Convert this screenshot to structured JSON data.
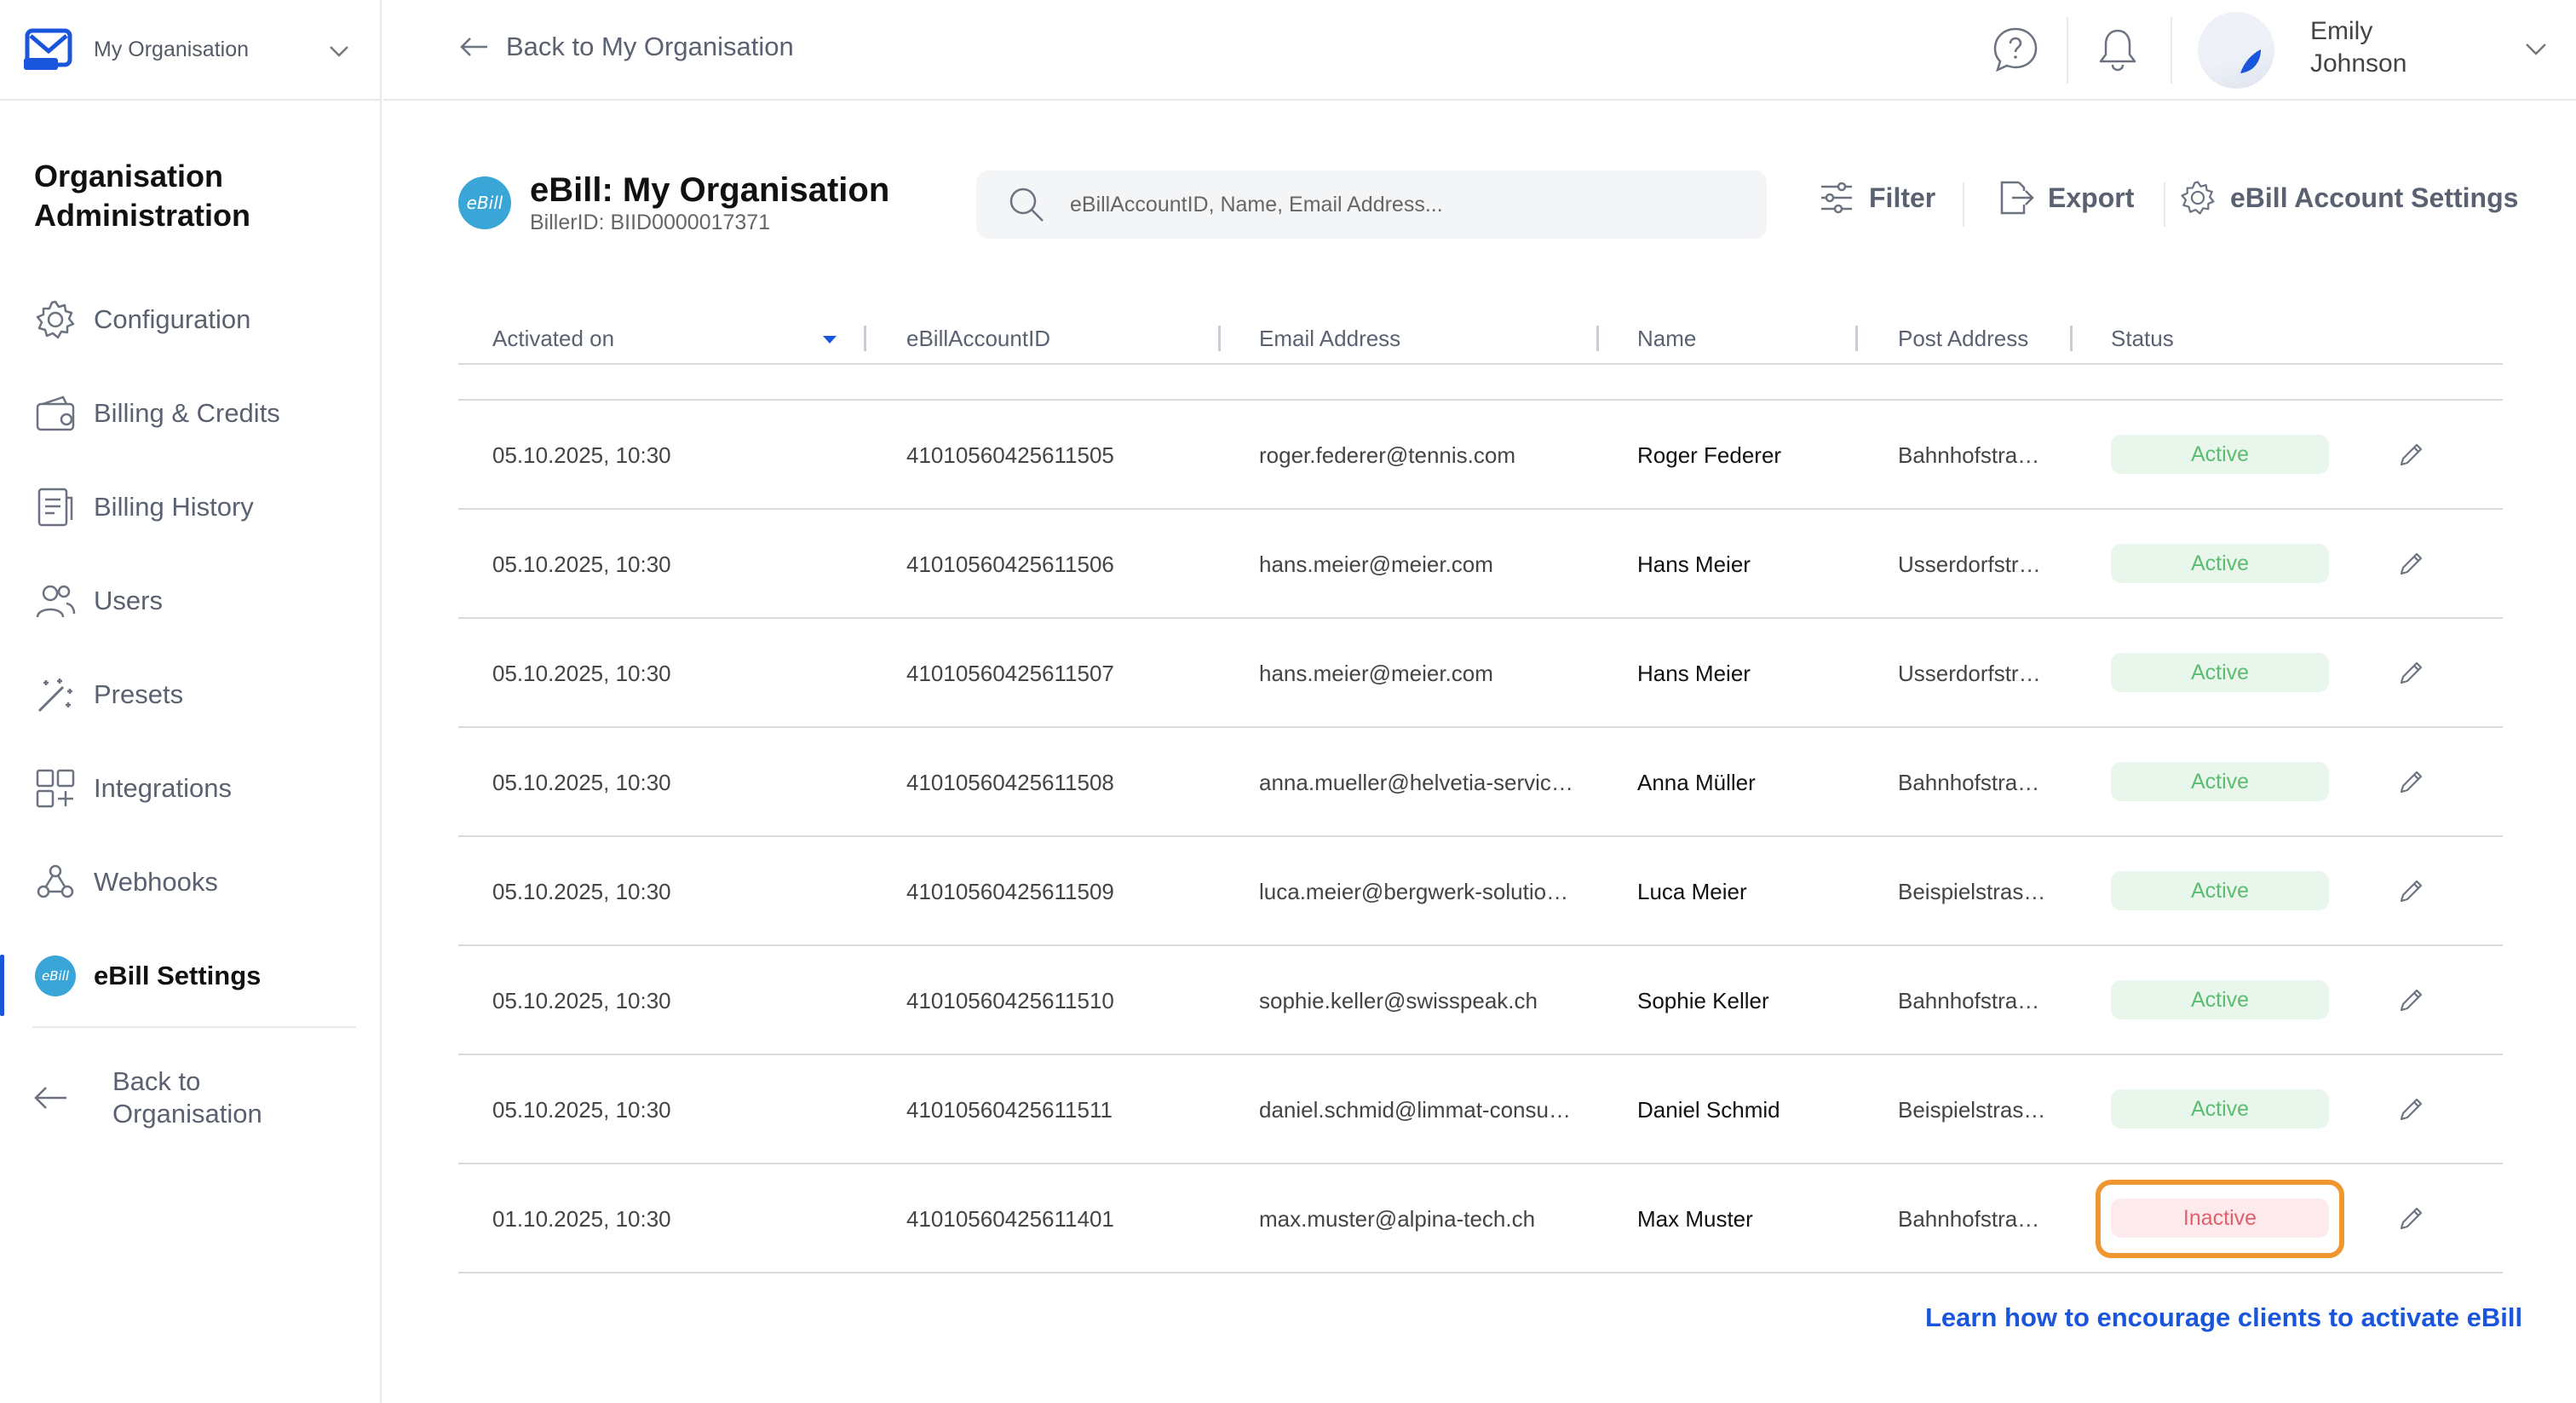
{
  "org_switcher": {
    "name": "My Organisation"
  },
  "sidebar": {
    "title": "Organisation Administration",
    "items": [
      {
        "label": "Configuration",
        "icon": "gear-icon"
      },
      {
        "label": "Billing & Credits",
        "icon": "wallet-icon"
      },
      {
        "label": "Billing History",
        "icon": "document-icon"
      },
      {
        "label": "Users",
        "icon": "users-icon"
      },
      {
        "label": "Presets",
        "icon": "magic-wand-icon"
      },
      {
        "label": "Integrations",
        "icon": "grid-plus-icon"
      },
      {
        "label": "Webhooks",
        "icon": "webhook-icon"
      },
      {
        "label": "eBill Settings",
        "icon": "ebill-icon",
        "active": true
      }
    ],
    "back_label": "Back to Organisation"
  },
  "topbar": {
    "back_label": "Back to My Organisation",
    "user": {
      "first": "Emily",
      "last": "Johnson"
    }
  },
  "page": {
    "badge": "eBill",
    "title": "eBill: My Organisation",
    "subtitle": "BillerID: BIID0000017371",
    "search_placeholder": "eBillAccountID, Name, Email Address...",
    "filter_label": "Filter",
    "export_label": "Export",
    "settings_label": "eBill Account Settings"
  },
  "table": {
    "headers": {
      "activated": "Activated on",
      "account_id": "eBillAccountID",
      "email": "Email Address",
      "name": "Name",
      "post": "Post Address",
      "status": "Status"
    },
    "rows": [
      {
        "activated": "05.10.2025, 10:30",
        "account_id": "41010560425611505",
        "email": "roger.federer@tennis.com",
        "name": "Roger Federer",
        "post": "Bahnhofstra…",
        "status": "Active"
      },
      {
        "activated": "05.10.2025, 10:30",
        "account_id": "41010560425611506",
        "email": "hans.meier@meier.com",
        "name": "Hans Meier",
        "post": "Usserdorfstr…",
        "status": "Active"
      },
      {
        "activated": "05.10.2025, 10:30",
        "account_id": "41010560425611507",
        "email": "hans.meier@meier.com",
        "name": "Hans Meier",
        "post": "Usserdorfstr…",
        "status": "Active"
      },
      {
        "activated": "05.10.2025, 10:30",
        "account_id": "41010560425611508",
        "email": "anna.mueller@helvetia-servic…",
        "name": "Anna Müller",
        "post": "Bahnhofstra…",
        "status": "Active"
      },
      {
        "activated": "05.10.2025, 10:30",
        "account_id": "41010560425611509",
        "email": "luca.meier@bergwerk-solutio…",
        "name": "Luca Meier",
        "post": "Beispielstras…",
        "status": "Active"
      },
      {
        "activated": "05.10.2025, 10:30",
        "account_id": "41010560425611510",
        "email": "sophie.keller@swisspeak.ch",
        "name": "Sophie Keller",
        "post": "Bahnhofstra…",
        "status": "Active"
      },
      {
        "activated": "05.10.2025, 10:30",
        "account_id": "41010560425611511",
        "email": "daniel.schmid@limmat-consu…",
        "name": "Daniel Schmid",
        "post": "Beispielstras…",
        "status": "Active"
      },
      {
        "activated": "01.10.2025, 10:30",
        "account_id": "41010560425611401",
        "email": "max.muster@alpina-tech.ch",
        "name": "Max Muster",
        "post": "Bahnhofstra…",
        "status": "Inactive"
      }
    ]
  },
  "footer_link": "Learn how to encourage clients to activate eBill",
  "colors": {
    "accent": "#1a56db",
    "active_bg": "#e9f6ec",
    "active_text": "#5bbd72",
    "inactive_bg": "#fdeaec",
    "inactive_text": "#e0606c",
    "highlight": "#f0962f",
    "ebill_badge": "#3aa6d8"
  }
}
